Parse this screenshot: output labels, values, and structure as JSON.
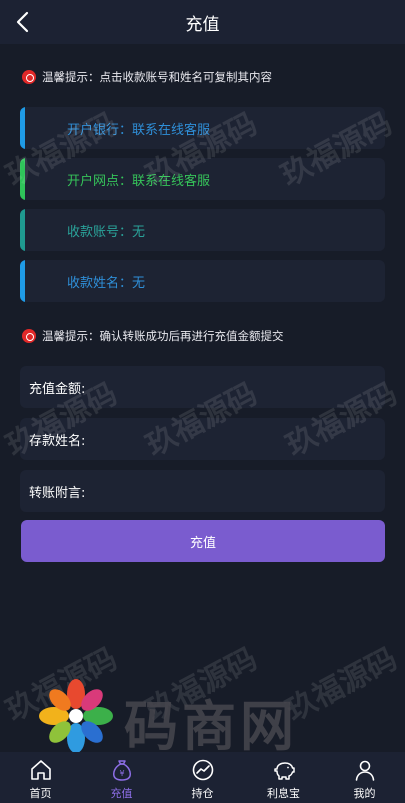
{
  "header": {
    "title": "充值"
  },
  "tips": {
    "tip1": "温馨提示：点击收款账号和姓名可复制其内容",
    "tip2": "温馨提示：确认转账成功后再进行充值金额提交"
  },
  "bank_info": [
    {
      "text": "开户银行：联系在线客服",
      "color": "#2f8fd8",
      "bar_color": "#1f9be6"
    },
    {
      "text": "开户网点：联系在线客服",
      "color": "#36c45a",
      "bar_color": "#2fc35a"
    },
    {
      "text": "收款账号：无",
      "color": "#2aa39a",
      "bar_color": "#1f9a90"
    },
    {
      "text": "收款姓名：无",
      "color": "#2f8fd8",
      "bar_color": "#1f9be6"
    }
  ],
  "form": {
    "amount_label": "充值金额:",
    "name_label": "存款姓名:",
    "note_label": "转账附言:",
    "amount_value": "",
    "name_value": "",
    "note_value": "",
    "submit_label": "充值"
  },
  "watermark": {
    "text": "玖福源码",
    "brand": "码商网"
  },
  "tabbar": [
    {
      "label": "首页",
      "icon": "home-icon",
      "active": false
    },
    {
      "label": "充值",
      "icon": "money-bag-icon",
      "active": true
    },
    {
      "label": "持仓",
      "icon": "chart-circle-icon",
      "active": false
    },
    {
      "label": "利息宝",
      "icon": "piggy-bank-icon",
      "active": false
    },
    {
      "label": "我的",
      "icon": "user-icon",
      "active": false
    }
  ],
  "colors": {
    "accent": "#7a5ccf",
    "active_tab": "#8d6ee6",
    "background": "#171c28"
  }
}
